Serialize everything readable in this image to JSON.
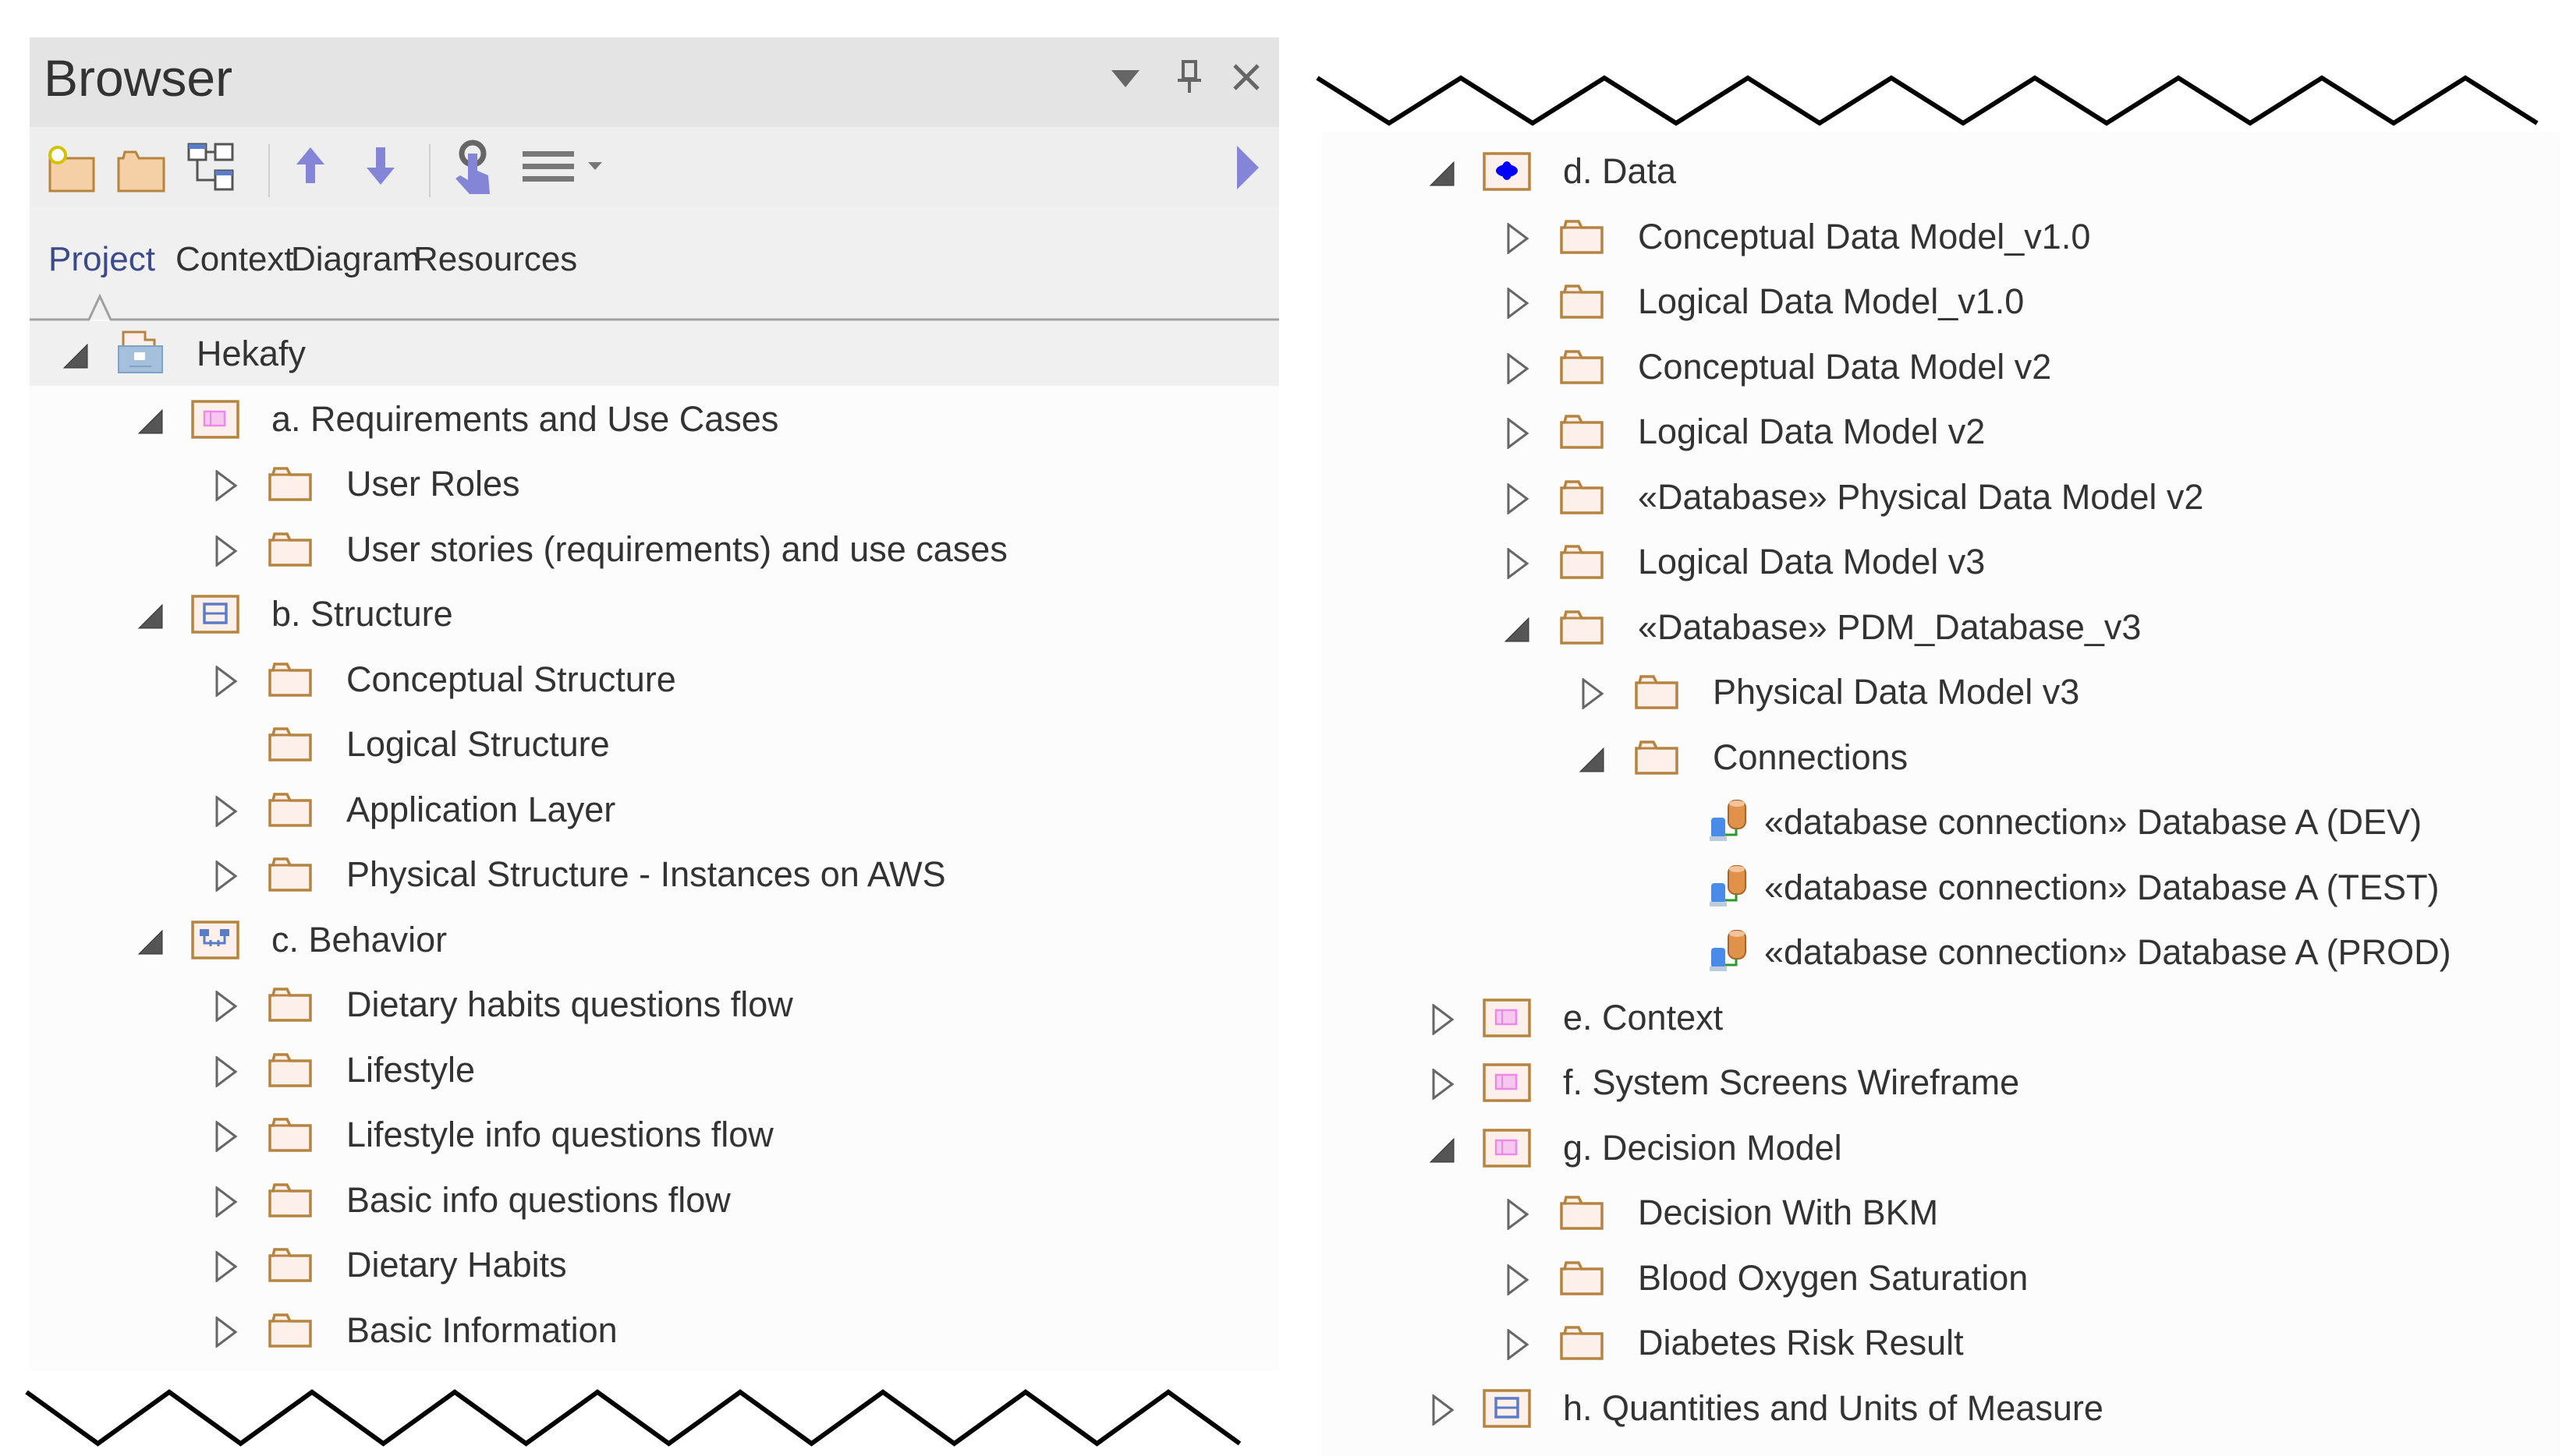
{
  "browser": {
    "title": "Browser",
    "header_buttons": [
      "dropdown-icon",
      "pin-icon",
      "close-icon"
    ],
    "toolbar": [
      {
        "name": "new-package-button",
        "icon": "new-folder-icon"
      },
      {
        "name": "new-folder-button",
        "icon": "folder-icon"
      },
      {
        "name": "new-diagram-button",
        "icon": "hierarchy-icon"
      },
      {
        "name": "move-up-button",
        "icon": "arrow-up-icon"
      },
      {
        "name": "move-down-button",
        "icon": "arrow-down-icon"
      },
      {
        "name": "locate-button",
        "icon": "touch-hand-icon"
      },
      {
        "name": "options-menu-button",
        "icon": "menu-icon"
      },
      {
        "name": "more-button",
        "icon": "chevron-right-icon"
      }
    ],
    "tabs": [
      {
        "label": "Project",
        "active": true
      },
      {
        "label": "Context",
        "active": false
      },
      {
        "label": "Diagram",
        "active": false
      },
      {
        "label": "Resources",
        "active": false
      }
    ]
  },
  "left_tree": [
    {
      "label": "Hekafy",
      "level": 0,
      "expander": "expanded",
      "icon": "model-root",
      "selected": true
    },
    {
      "label": "a. Requirements and Use Cases",
      "level": 1,
      "expander": "expanded",
      "icon": "package-requirements"
    },
    {
      "label": "User Roles",
      "level": 2,
      "expander": "collapsed",
      "icon": "folder"
    },
    {
      "label": "User stories (requirements) and use cases",
      "level": 2,
      "expander": "collapsed",
      "icon": "folder"
    },
    {
      "label": "b. Structure",
      "level": 1,
      "expander": "expanded",
      "icon": "package-structure"
    },
    {
      "label": "Conceptual Structure",
      "level": 2,
      "expander": "collapsed",
      "icon": "folder"
    },
    {
      "label": "Logical Structure",
      "level": 2,
      "expander": "none",
      "icon": "folder"
    },
    {
      "label": "Application Layer",
      "level": 2,
      "expander": "collapsed",
      "icon": "folder"
    },
    {
      "label": "Physical Structure - Instances on AWS",
      "level": 2,
      "expander": "collapsed",
      "icon": "folder"
    },
    {
      "label": "c. Behavior",
      "level": 1,
      "expander": "expanded",
      "icon": "package-behavior"
    },
    {
      "label": "Dietary habits questions flow",
      "level": 2,
      "expander": "collapsed",
      "icon": "folder"
    },
    {
      "label": "Lifestyle",
      "level": 2,
      "expander": "collapsed",
      "icon": "folder"
    },
    {
      "label": "Lifestyle info questions flow",
      "level": 2,
      "expander": "collapsed",
      "icon": "folder"
    },
    {
      "label": "Basic info questions flow",
      "level": 2,
      "expander": "collapsed",
      "icon": "folder"
    },
    {
      "label": "Dietary Habits",
      "level": 2,
      "expander": "collapsed",
      "icon": "folder"
    },
    {
      "label": "Basic Information",
      "level": 2,
      "expander": "collapsed",
      "icon": "folder"
    }
  ],
  "right_tree": [
    {
      "label": "d.  Data",
      "level": 1,
      "expander": "expanded",
      "icon": "package-data"
    },
    {
      "label": "Conceptual Data Model_v1.0",
      "level": 2,
      "expander": "collapsed",
      "icon": "folder"
    },
    {
      "label": "Logical Data Model_v1.0",
      "level": 2,
      "expander": "collapsed",
      "icon": "folder"
    },
    {
      "label": "Conceptual Data Model v2",
      "level": 2,
      "expander": "collapsed",
      "icon": "folder"
    },
    {
      "label": "Logical Data Model v2",
      "level": 2,
      "expander": "collapsed",
      "icon": "folder"
    },
    {
      "label": "«Database» Physical Data Model v2",
      "level": 2,
      "expander": "collapsed",
      "icon": "folder"
    },
    {
      "label": "Logical Data Model v3",
      "level": 2,
      "expander": "collapsed",
      "icon": "folder"
    },
    {
      "label": "«Database» PDM_Database_v3",
      "level": 2,
      "expander": "expanded",
      "icon": "folder"
    },
    {
      "label": "Physical Data Model v3",
      "level": 3,
      "expander": "collapsed",
      "icon": "folder"
    },
    {
      "label": "Connections",
      "level": 3,
      "expander": "expanded",
      "icon": "folder"
    },
    {
      "label": "«database connection» Database A (DEV)",
      "level": 4,
      "expander": "none",
      "icon": "database-connection"
    },
    {
      "label": "«database connection» Database A (TEST)",
      "level": 4,
      "expander": "none",
      "icon": "database-connection"
    },
    {
      "label": "«database connection» Database A (PROD)",
      "level": 4,
      "expander": "none",
      "icon": "database-connection"
    },
    {
      "label": "e. Context",
      "level": 1,
      "expander": "collapsed",
      "icon": "package-requirements"
    },
    {
      "label": "f. System Screens Wireframe",
      "level": 1,
      "expander": "collapsed",
      "icon": "package-requirements"
    },
    {
      "label": "g. Decision Model",
      "level": 1,
      "expander": "expanded",
      "icon": "package-requirements"
    },
    {
      "label": "Decision With BKM",
      "level": 2,
      "expander": "collapsed",
      "icon": "folder"
    },
    {
      "label": "Blood Oxygen Saturation",
      "level": 2,
      "expander": "collapsed",
      "icon": "folder"
    },
    {
      "label": "Diabetes Risk Result",
      "level": 2,
      "expander": "collapsed",
      "icon": "folder"
    },
    {
      "label": "h. Quantities and Units of Measure",
      "level": 1,
      "expander": "collapsed",
      "icon": "package-structure"
    }
  ],
  "colors": {
    "header_bg": "#e4e4e4",
    "toolbar_bg": "#eeeeee",
    "tree_bg": "#fcfcfc",
    "selected_row_bg": "#f0f0f0",
    "folder_stroke": "#b7843f",
    "folder_fill": "#fdf0ea",
    "accent_blue": "#8585d8",
    "active_tab": "#3b4a8a"
  }
}
